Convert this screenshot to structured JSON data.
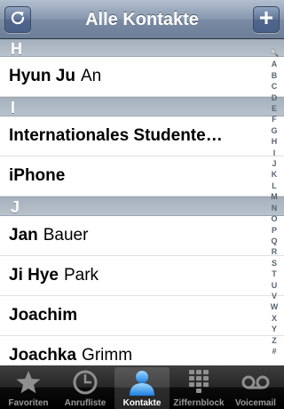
{
  "navbar": {
    "title": "Alle Kontakte",
    "left_icon": "refresh-icon",
    "right_icon": "plus-icon"
  },
  "sections": [
    {
      "letter": "H",
      "contacts": [
        {
          "given": "Hyun Ju",
          "family": "An"
        }
      ]
    },
    {
      "letter": "I",
      "contacts": [
        {
          "given": "Internationales Studente…",
          "family": ""
        },
        {
          "given": "iPhone",
          "family": ""
        }
      ]
    },
    {
      "letter": "J",
      "contacts": [
        {
          "given": "Jan",
          "family": "Bauer"
        },
        {
          "given": "Ji Hye",
          "family": "Park"
        },
        {
          "given": "Joachim",
          "family": ""
        },
        {
          "given": "Joachka",
          "family": "Grimm"
        }
      ]
    }
  ],
  "index_letters": [
    "🔍",
    "A",
    "B",
    "C",
    "D",
    "E",
    "F",
    "G",
    "H",
    "I",
    "J",
    "K",
    "L",
    "M",
    "N",
    "O",
    "P",
    "Q",
    "R",
    "S",
    "T",
    "U",
    "V",
    "W",
    "X",
    "Y",
    "Z",
    "#"
  ],
  "tabbar": {
    "tabs": [
      {
        "label": "Favoriten",
        "icon": "star-icon",
        "active": false
      },
      {
        "label": "Anrufliste",
        "icon": "clock-icon",
        "active": false
      },
      {
        "label": "Kontakte",
        "icon": "person-icon",
        "active": true
      },
      {
        "label": "Ziffernblock",
        "icon": "keypad-icon",
        "active": false
      },
      {
        "label": "Voicemail",
        "icon": "voicemail-icon",
        "active": false
      }
    ]
  }
}
